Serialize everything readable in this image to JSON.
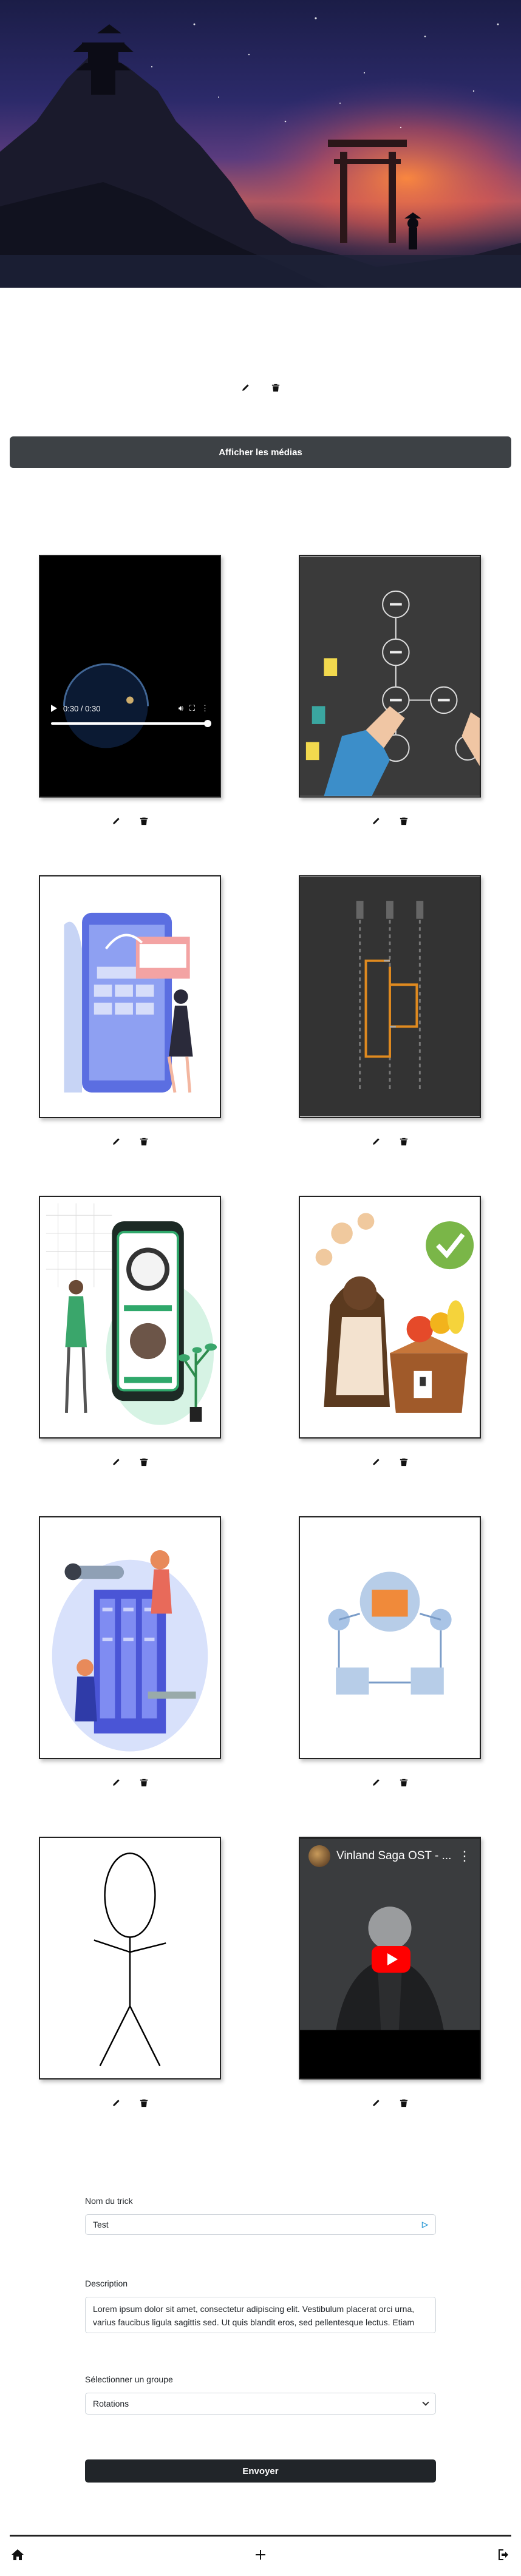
{
  "hero": {
    "edit_icon": "pencil-icon",
    "delete_icon": "trash-icon"
  },
  "media_toggle": {
    "label": "Afficher les médias"
  },
  "media": [
    {
      "type": "video",
      "time": "0:30 / 0:30"
    },
    {
      "type": "image",
      "subject": "hands-flowchart"
    },
    {
      "type": "image",
      "subject": "website-wireframe"
    },
    {
      "type": "image",
      "subject": "dark-flowchart"
    },
    {
      "type": "image",
      "subject": "mobile-food-app"
    },
    {
      "type": "image",
      "subject": "fruit-basket-check"
    },
    {
      "type": "image",
      "subject": "server-team"
    },
    {
      "type": "image",
      "subject": "blue-diagram"
    },
    {
      "type": "image",
      "subject": "stick-figure"
    },
    {
      "type": "youtube",
      "title": "Vinland Saga OST - ..."
    }
  ],
  "form": {
    "name_label": "Nom du trick",
    "name_value": "Test",
    "description_label": "Description",
    "description_value": "Lorem ipsum dolor sit amet, consectetur adipiscing elit. Vestibulum placerat orci urna, varius faucibus ligula sagittis sed. Ut quis blandit eros, sed pellentesque lectus. Etiam",
    "group_label": "Sélectionner un groupe",
    "group_value": "Rotations",
    "submit_label": "Envoyer"
  },
  "nav": {
    "home_icon": "home-icon",
    "add_icon": "plus-icon",
    "logout_icon": "logout-icon"
  }
}
